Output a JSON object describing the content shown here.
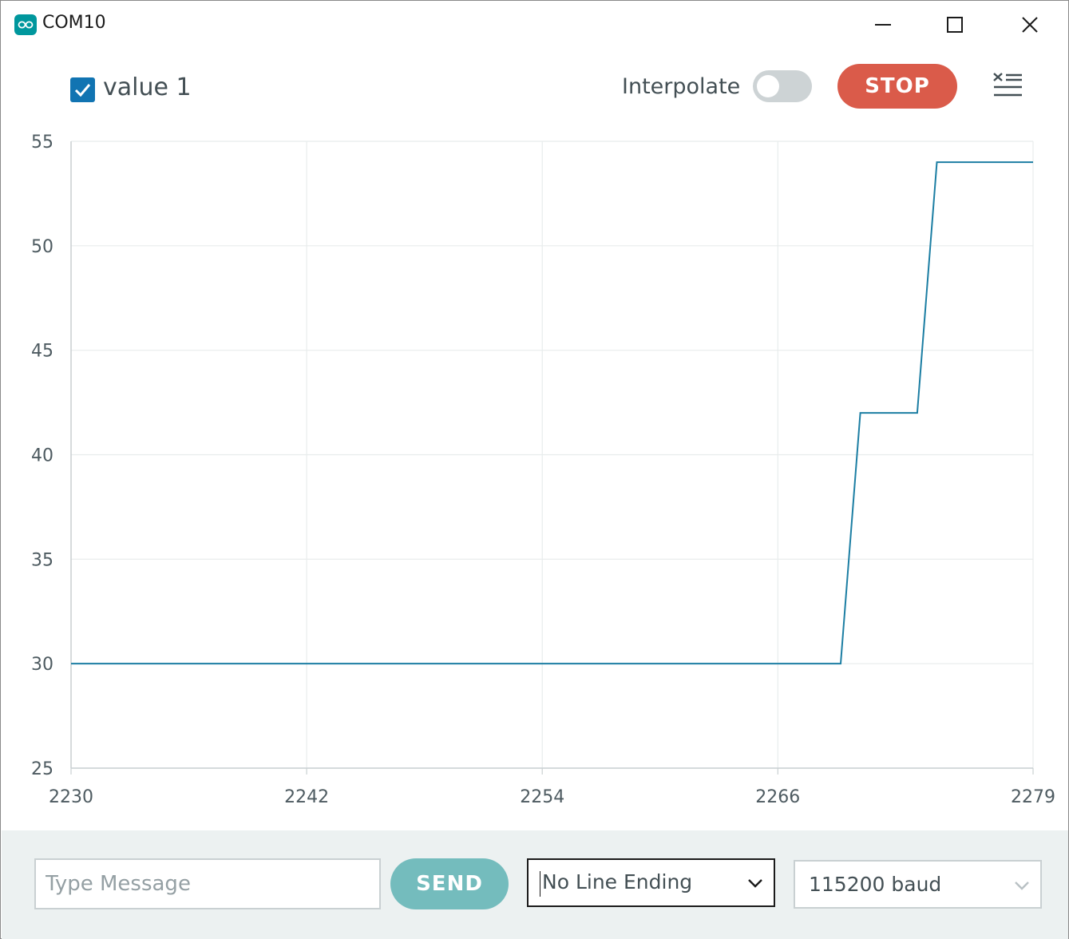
{
  "window": {
    "title": "COM10"
  },
  "toolbar": {
    "series_label": "value 1",
    "series_checked": true,
    "interpolate_label": "Interpolate",
    "interpolate_on": false,
    "stop_label": "STOP"
  },
  "colors": {
    "series": "#1c7ea3",
    "stop": "#da5b4a",
    "send": "#74bcbd",
    "checkbox": "#1174b2",
    "brand": "#00979d"
  },
  "chart_data": {
    "type": "line",
    "xlabel": "",
    "ylabel": "",
    "xlim": [
      2230,
      2279
    ],
    "ylim": [
      25,
      55
    ],
    "x_ticks": [
      "2230",
      "2242",
      "2254",
      "2266",
      "2279"
    ],
    "y_ticks": [
      "25",
      "30",
      "35",
      "40",
      "45",
      "50",
      "55"
    ],
    "grid": true,
    "series": [
      {
        "name": "value 1",
        "points": [
          [
            2230,
            30
          ],
          [
            2269.2,
            30
          ],
          [
            2270.2,
            42
          ],
          [
            2273.1,
            42
          ],
          [
            2274.1,
            54
          ],
          [
            2279,
            54
          ]
        ]
      }
    ]
  },
  "bottom": {
    "message_placeholder": "Type Message",
    "send_label": "SEND",
    "line_ending": "No Line Ending",
    "baud": "115200 baud"
  }
}
